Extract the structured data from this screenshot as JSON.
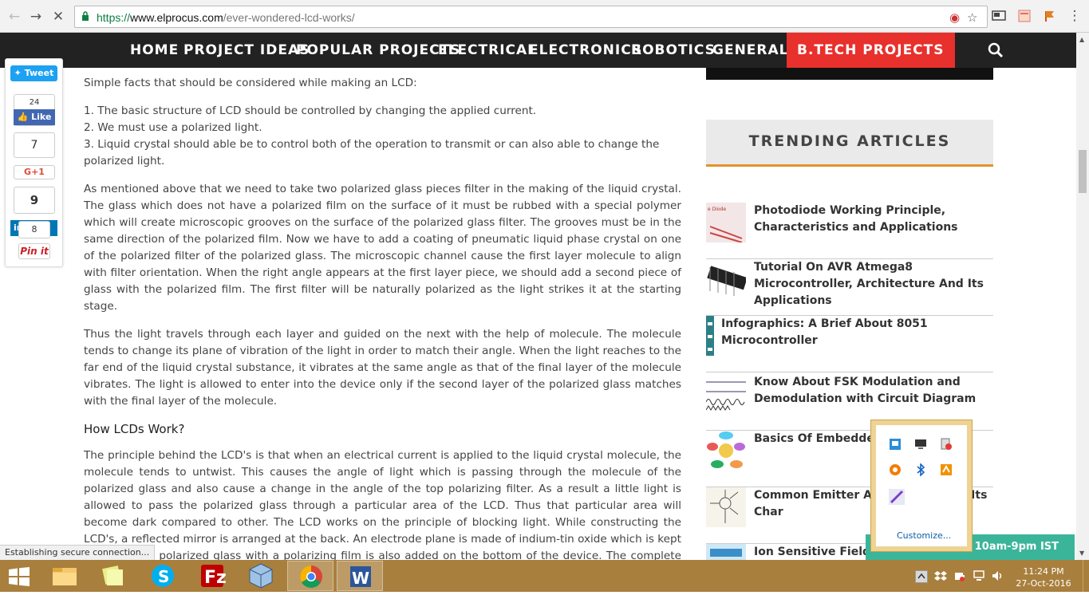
{
  "browser": {
    "url_scheme": "https://",
    "url_host": "www.elprocus.com",
    "url_path": "/ever-wondered-lcd-works/",
    "status_text": "Establishing secure connection..."
  },
  "nav": {
    "items": [
      "HOME",
      "PROJECT IDEAS",
      "POPULAR PROJECTS",
      "ELECTRICAL",
      "ELECTRONICS",
      "ROBOTICS",
      "GENERAL +",
      "B.TECH PROJECTS"
    ]
  },
  "share": {
    "tweet": "Tweet",
    "fb_count": "24",
    "fb_like": "Like",
    "gplus_count": "7",
    "gplus_label": "G+1",
    "in_count": "9",
    "in_share": "in",
    "pin_count": "8",
    "pin_label": "Pin it"
  },
  "article": {
    "intro": "Simple facts that should be considered while making an LCD:",
    "facts": [
      "1. The basic structure of LCD should be controlled by changing the applied current.",
      "2. We must use a polarized light.",
      "3. Liquid crystal should able be to control both of the operation to transmit or can also able to change the polarized light."
    ],
    "para1": "As mentioned above that we need to take two polarized glass pieces filter in the making of the liquid crystal. The glass which does not have a polarized film on the surface of it must be rubbed with a special polymer which will create microscopic grooves on the surface of the polarized glass filter. The grooves must be in the same direction of the polarized film. Now we have to add a coating of pneumatic liquid phase crystal on one of the polarized filter of the polarized glass. The microscopic channel cause the first layer molecule to align with filter orientation. When the right angle appears at the first layer piece, we should add a second piece of glass with the polarized film. The first filter will be naturally polarized as the light strikes it at the starting stage.",
    "para2": "Thus the light travels through each layer and guided on the next with the help of molecule. The molecule tends to change its plane of vibration of the light in order to match their angle.  When the light reaches to the far end of the liquid crystal substance, it vibrates at the same angle as that of the final layer of the molecule vibrates. The light is allowed to enter into the device only if the second layer of the polarized glass matches with the final layer of the molecule.",
    "heading": "How LCDs Work?",
    "para3": "The principle behind the LCD's is that when an electrical current is applied to the liquid crystal molecule, the molecule tends to untwist. This causes the angle of light which is passing through the molecule of the polarized glass and also cause a change in the angle of the top polarizing filter. As a result a little light is allowed to pass the polarized glass through a particular area of the LCD. Thus that particular area will become dark compared to other. The LCD works on the principle of blocking light. While constructing the LCD's, a reflected mirror is arranged at the back. An electrode plane is made of indium-tin oxide which is kept on top and a polarized glass with a polarizing film is also added on the bottom of the device. The complete region of the LCD has to be enclosed by a common"
  },
  "sidebar": {
    "trending_title": "TRENDING ARTICLES",
    "items": [
      {
        "title": "Photodiode Working Principle, Characteristics and Applications"
      },
      {
        "title": "Tutorial On AVR Atmega8 Microcontroller, Architecture And Its Applications"
      },
      {
        "title": "Infographics: A Brief About 8051 Microcontroller"
      },
      {
        "title": "Know About FSK Modulation and Demodulation with Circuit Diagram"
      },
      {
        "title": "Basics Of Embedded Applications"
      },
      {
        "title": "Common Emitter Am Working and Its Char"
      },
      {
        "title": "Ion Sensitive Field-E"
      }
    ]
  },
  "tray_popup": {
    "customize": "Customize..."
  },
  "chat_badge": "t 10am-9pm IST",
  "taskbar": {
    "time": "11:24 PM",
    "date": "27-Oct-2016"
  },
  "colors": {
    "nav_bg": "#222222",
    "btech_bg": "#e8302c",
    "trending_accent": "#e3932a",
    "taskbar": "#a97f3d",
    "chat_badge": "#3bb59a"
  }
}
